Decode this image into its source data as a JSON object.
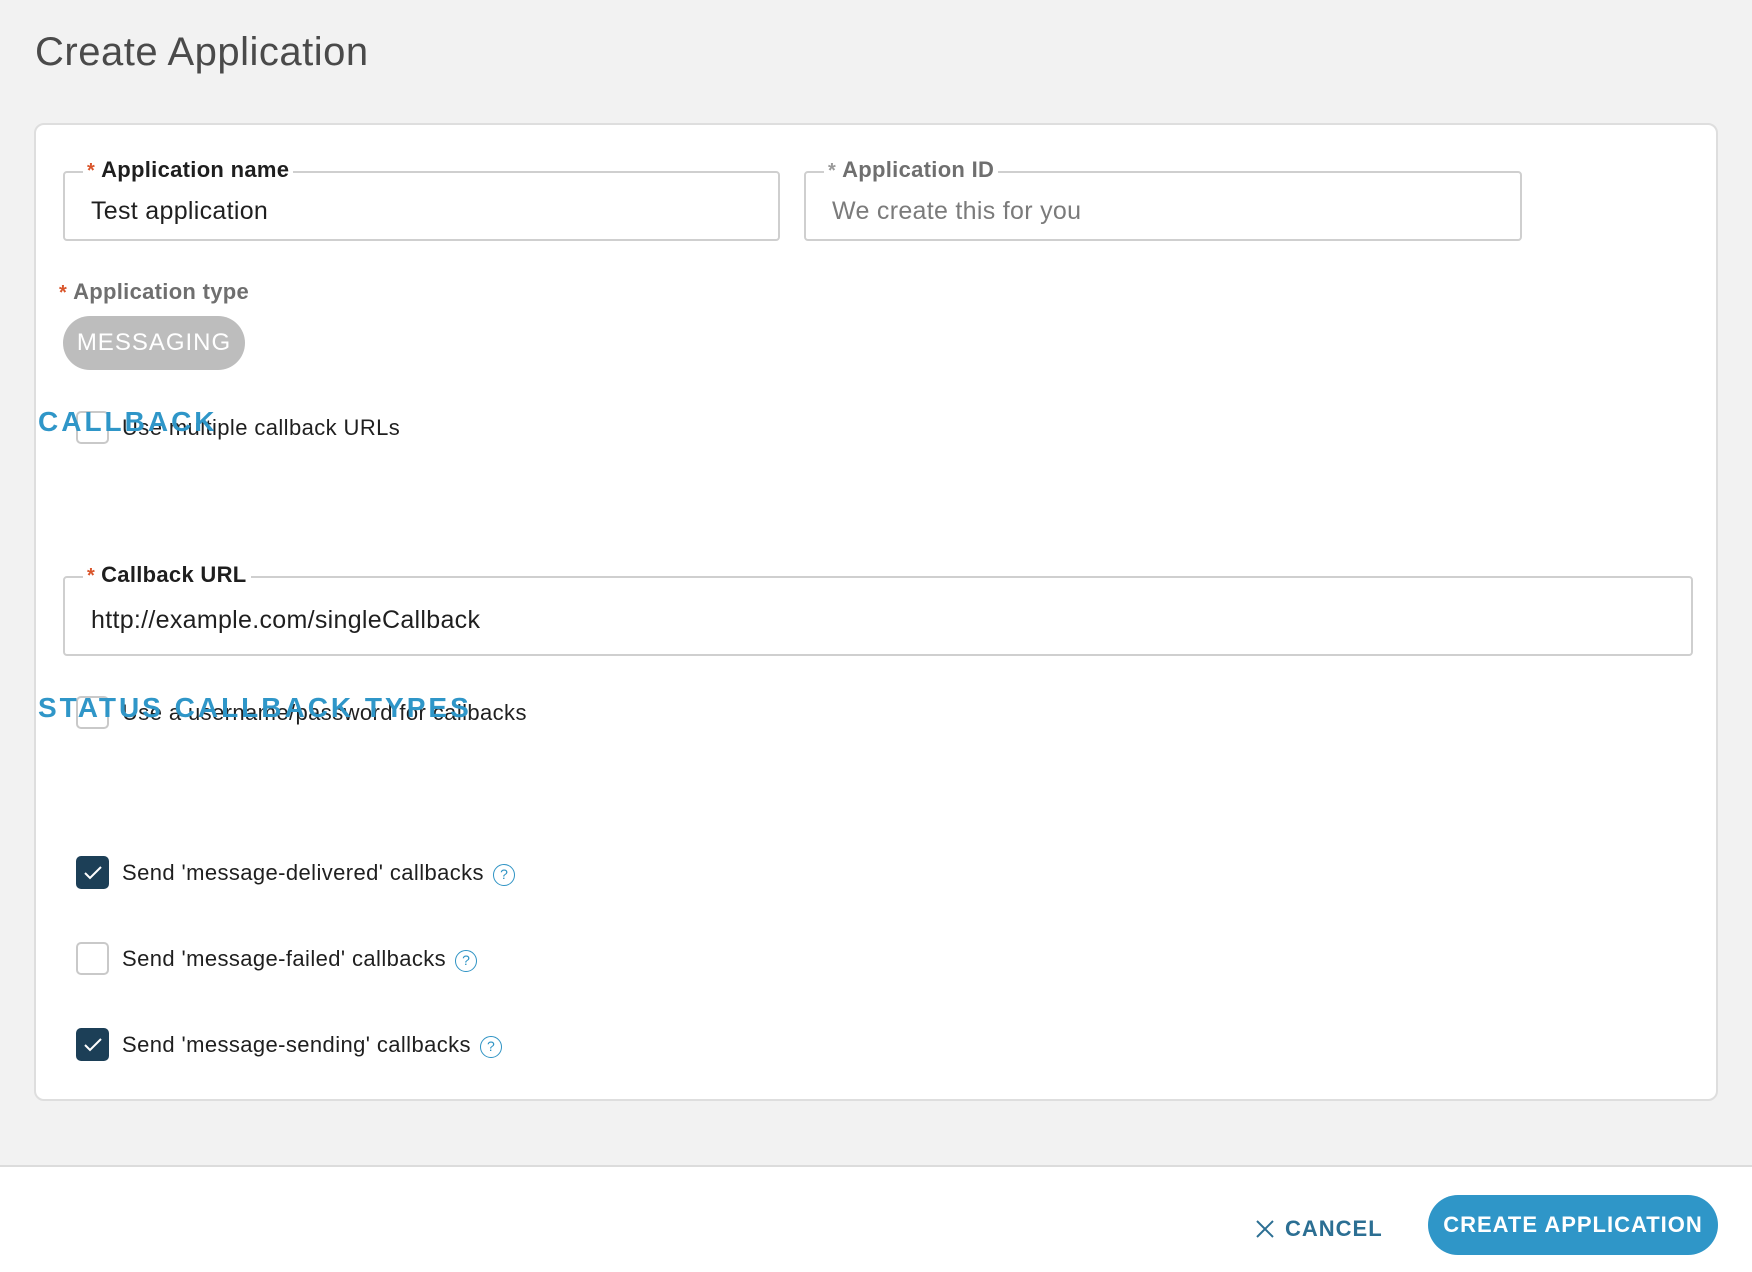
{
  "page": {
    "title": "Create Application"
  },
  "form": {
    "app_name": {
      "label": "Application name",
      "required_mark": "*",
      "value": "Test application"
    },
    "app_id": {
      "label": "Application ID",
      "required_mark": "*",
      "placeholder": "We create this for you"
    },
    "app_type": {
      "label": "Application type",
      "required_mark": "*",
      "chip": "MESSAGING"
    },
    "multiple_callbacks": {
      "label": "Use multiple callback URLs",
      "checked": false
    },
    "callback_section": {
      "heading": "CALLBACK"
    },
    "callback_url": {
      "label": "Callback URL",
      "required_mark": "*",
      "value": "http://example.com/singleCallback"
    },
    "username_password": {
      "label": "Use a username/password for callbacks",
      "checked": false
    },
    "status_section": {
      "heading": "STATUS CALLBACK TYPES"
    },
    "status_callbacks": [
      {
        "label": "Send 'message-delivered' callbacks",
        "checked": true,
        "help": "?"
      },
      {
        "label": "Send 'message-failed' callbacks",
        "checked": false,
        "help": "?"
      },
      {
        "label": "Send 'message-sending' callbacks",
        "checked": true,
        "help": "?"
      }
    ]
  },
  "footer": {
    "cancel_label": "CANCEL",
    "create_label": "CREATE APPLICATION"
  },
  "colors": {
    "accent": "#2f96c8",
    "checked_box": "#1c3f57",
    "required_mark": "#d9552b",
    "chip_bg": "#bdbdbd"
  },
  "icons": {
    "cancel": "close-icon",
    "help": "help-icon",
    "check": "checkmark-icon"
  }
}
